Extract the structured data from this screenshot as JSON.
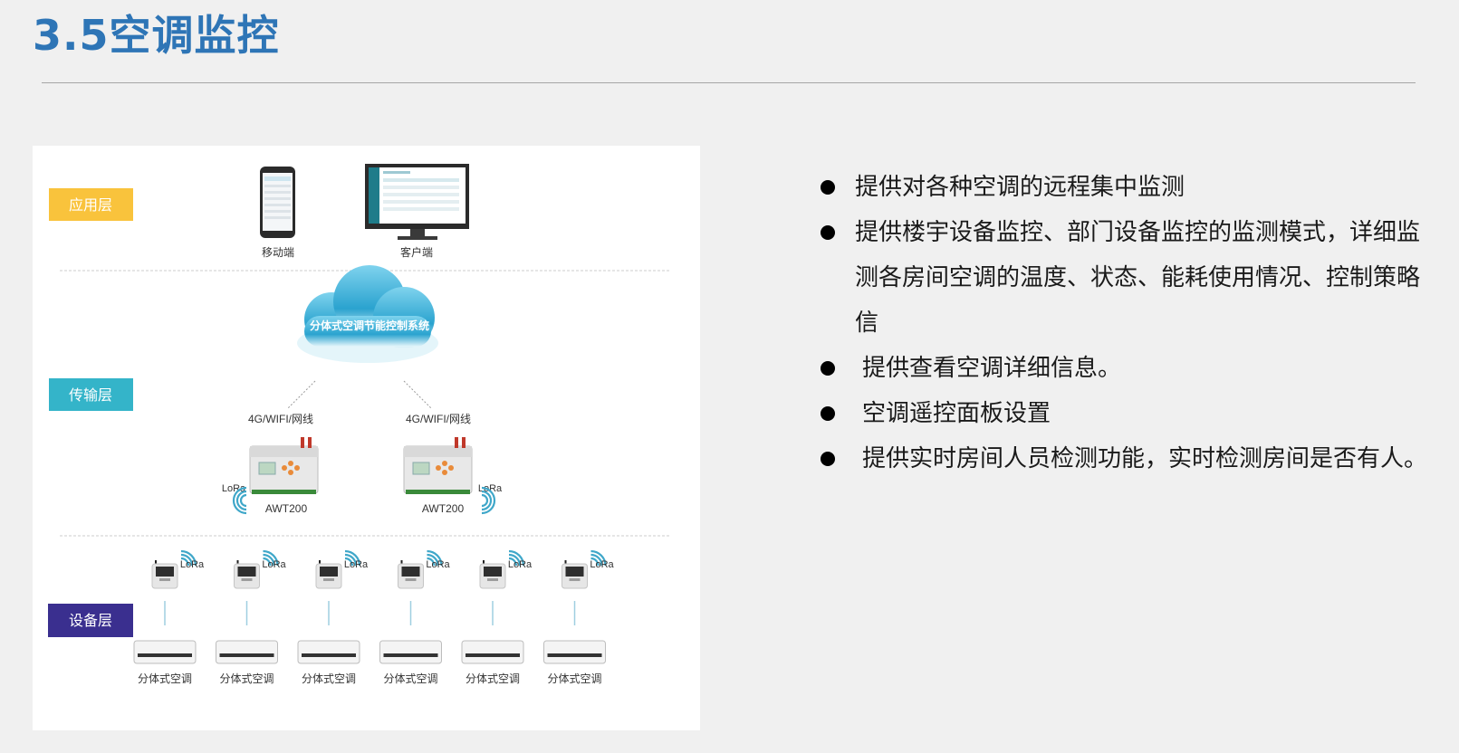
{
  "title": "3.5空调监控",
  "diagram": {
    "layers": {
      "application": "应用层",
      "transport": "传输层",
      "device": "设备层"
    },
    "colors": {
      "application": "#f9c33c",
      "transport": "#34b4c9",
      "device": "#3a2f8f",
      "cloud": "#3fb1d6"
    },
    "clients": {
      "mobile": "移动端",
      "desktop": "客户端"
    },
    "cloud_label": "分体式空调节能控制系统",
    "gateway_link_label": "4G/WIFI/网线",
    "gateway_name": "AWT200",
    "lora_label": "LoRa",
    "ac_unit_label": "分体式空调",
    "device_count": 6
  },
  "bullets": [
    "提供对各种空调的远程集中监测",
    "提供楼宇设备监控、部门设备监控的监测模式，详细监测各房间空调的温度、状态、能耗使用情况、控制策略信",
    "提供查看空调详细信息。",
    "空调遥控面板设置",
    "提供实时房间人员检测功能，实时检测房间是否有人。"
  ]
}
